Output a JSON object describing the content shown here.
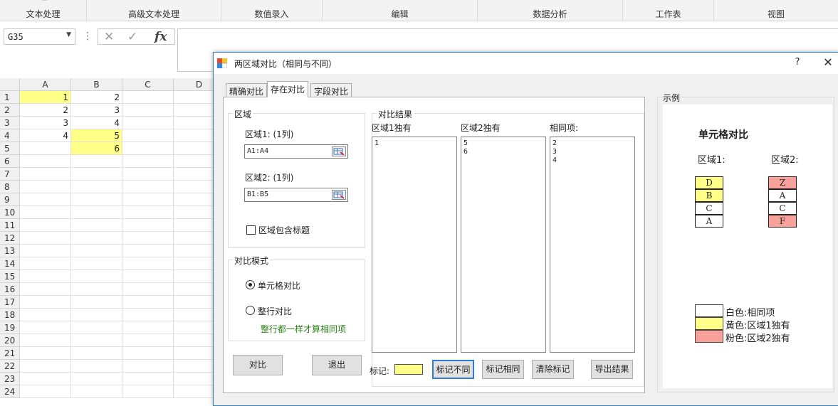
{
  "ribbon": {
    "groups": [
      "文本处理",
      "高级文本处理",
      "数值录入",
      "编辑",
      "数据分析",
      "工作表",
      "视图"
    ]
  },
  "formula_bar": {
    "name_box": "G35",
    "fx": "fx",
    "cancel_icon": "close-icon",
    "confirm_icon": "check-icon",
    "value": ""
  },
  "sheet": {
    "columns": [
      "A",
      "B",
      "C",
      "D"
    ],
    "rows": [
      "1",
      "2",
      "3",
      "4",
      "5",
      "6",
      "7",
      "8",
      "9",
      "10",
      "11",
      "12",
      "13",
      "14",
      "15",
      "16",
      "17",
      "18",
      "19",
      "20",
      "21",
      "22",
      "23",
      "24"
    ],
    "col_a": [
      "1",
      "2",
      "3",
      "4",
      ""
    ],
    "col_b": [
      "2",
      "3",
      "4",
      "5",
      "6"
    ],
    "highlight_color": "#ffff88"
  },
  "dialog": {
    "title": "两区域对比（相同与不同）",
    "help": "?",
    "close": "✕",
    "tabs": [
      "精确对比",
      "存在对比",
      "字段对比"
    ],
    "active_tab": "存在对比",
    "region": {
      "title": "区域",
      "r1_label": "区域1:   (1列)",
      "r1_value": "A1:A4",
      "r2_label": "区域2:   (1列)",
      "r2_value": "B1:B5",
      "include_header": "区域包含标题",
      "include_header_checked": false
    },
    "mode": {
      "title": "对比模式",
      "options": [
        "单元格对比",
        "整行对比"
      ],
      "selected": "单元格对比",
      "hint": "整行都一样才算相同项",
      "hint_color": "#2e7d1a"
    },
    "compare_button": "对比",
    "exit_button": "退出",
    "results": {
      "title": "对比结果",
      "cols": [
        "区域1独有",
        "区域2独有",
        "相同项:"
      ],
      "region1_only": [
        "1"
      ],
      "region2_only": [
        "5",
        "6"
      ],
      "same": [
        "2",
        "3",
        "4"
      ]
    },
    "mark_label": "标记:",
    "mark_color": "#ffff88",
    "mark_diff_button": "标记不同",
    "mark_same_button": "标记相同",
    "clear_button": "清除标记",
    "export_button": "导出结果",
    "example": {
      "title": "示例",
      "heading": "单元格对比",
      "r1_label": "区域1:",
      "r2_label": "区域2:",
      "r1_cells": [
        "D",
        "B",
        "C",
        "A"
      ],
      "r2_cells": [
        "Z",
        "A",
        "C",
        "F"
      ],
      "legend": [
        "白色:相同项",
        "黄色:区域1独有",
        "粉色:区域2独有"
      ],
      "colors": {
        "white": "#ffffff",
        "yellow": "#ffff88",
        "pink": "#f9a19a"
      }
    }
  }
}
